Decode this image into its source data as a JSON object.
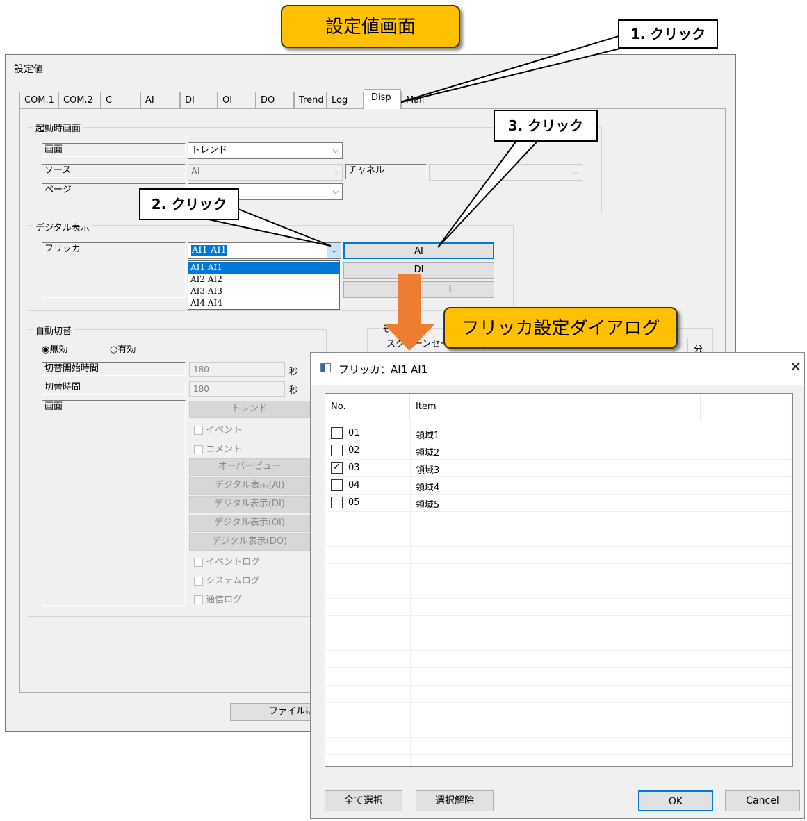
{
  "banner_title": "設定値画面",
  "callouts": {
    "step1": "1. クリック",
    "step2": "2. クリック",
    "step3": "3. クリック",
    "dialog_banner": "フリッカ設定ダイアログ"
  },
  "window": {
    "title": "設定値",
    "tabs": [
      "COM.1",
      "COM.2",
      "C",
      "AI",
      "DI",
      "OI",
      "DO",
      "Trend",
      "Log",
      "Disp",
      "Mail"
    ],
    "active_tab": "Disp",
    "startup": {
      "group_label": "起動時画面",
      "screen_label": "画面",
      "screen_value": "トレンド",
      "source_label": "ソース",
      "source_value": "AI",
      "channel_label": "チャネル",
      "channel_value": "",
      "page_label": "ページ",
      "page_value": ""
    },
    "digital": {
      "group_label": "デジタル表示",
      "flicker_label": "フリッカ",
      "combo_value": "AI1 AI1",
      "dropdown_options": [
        "AI1 AI1",
        "AI2 AI2",
        "AI3 AI3",
        "AI4 AI4"
      ],
      "selected_option": "AI1 AI1",
      "btn_ai": "AI",
      "btn_di": "DI",
      "btn_third": "I"
    },
    "auto": {
      "group_label": "自動切替",
      "radio_off": "無効",
      "radio_on": "有効",
      "radio_selected": "無効",
      "start_time_label": "切替開始時間",
      "start_time_value": "180",
      "start_time_unit": "秒",
      "switch_time_label": "切替時間",
      "switch_time_value": "180",
      "switch_time_unit": "秒",
      "screen_label": "画面",
      "btn_trend": "トレンド",
      "cb_event": "イベント",
      "cb_comment": "コメント",
      "btn_overview": "オーバービュー",
      "btn_dig_ai": "デジタル表示(AI)",
      "btn_dig_di": "デジタル表示(DI)",
      "btn_dig_oi": "デジタル表示(OI)",
      "btn_dig_do": "デジタル表示(DO)",
      "cb_eventlog": "イベントログ",
      "cb_systemlog": "システムログ",
      "cb_commlog": "通信ログ"
    },
    "other": {
      "group_label_partial": "その",
      "screensaver_partial": "スクリーンセーバ",
      "minute_unit": "分"
    },
    "save_button_partial": "ファイルに保"
  },
  "dialog": {
    "title": "フリッカ：AI1  AI1",
    "columns": [
      "No.",
      "Item"
    ],
    "rows": [
      {
        "no": "01",
        "item": "領域1",
        "checked": false
      },
      {
        "no": "02",
        "item": "領域2",
        "checked": false
      },
      {
        "no": "03",
        "item": "領域3",
        "checked": true
      },
      {
        "no": "04",
        "item": "領域4",
        "checked": false
      },
      {
        "no": "05",
        "item": "領域5",
        "checked": false
      }
    ],
    "select_all": "全て選択",
    "deselect": "選択解除",
    "ok": "OK",
    "cancel": "Cancel",
    "close_glyph": "✕"
  },
  "colors": {
    "banner": "#ffc000",
    "arrow": "#ed7d31",
    "selection": "#0078d7"
  }
}
